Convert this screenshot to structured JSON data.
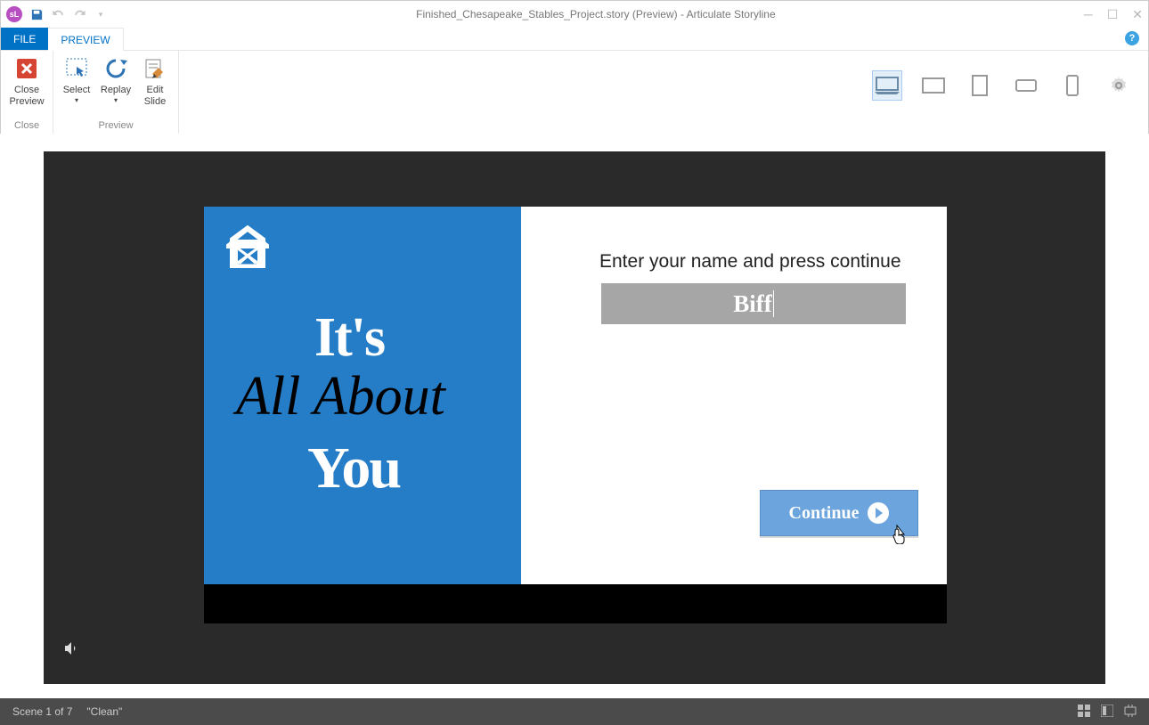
{
  "app_badge": "sL",
  "title": "Finished_Chesapeake_Stables_Project.story (Preview) -  Articulate Storyline",
  "tabs": {
    "file": "FILE",
    "preview": "PREVIEW"
  },
  "ribbon": {
    "close": {
      "line1": "Close",
      "line2": "Preview",
      "group": "Close"
    },
    "select": {
      "line1": "Select",
      "arrow": "▾"
    },
    "replay": {
      "line1": "Replay",
      "arrow": "▾"
    },
    "edit": {
      "line1": "Edit",
      "line2": "Slide"
    },
    "preview_group": "Preview"
  },
  "slide": {
    "its": "It's",
    "all_about": "All About",
    "you": "You",
    "prompt": "Enter your name and press continue",
    "name_value": "Biff",
    "continue": "Continue"
  },
  "status": {
    "scene": "Scene 1 of 7",
    "layer": "\"Clean\""
  }
}
